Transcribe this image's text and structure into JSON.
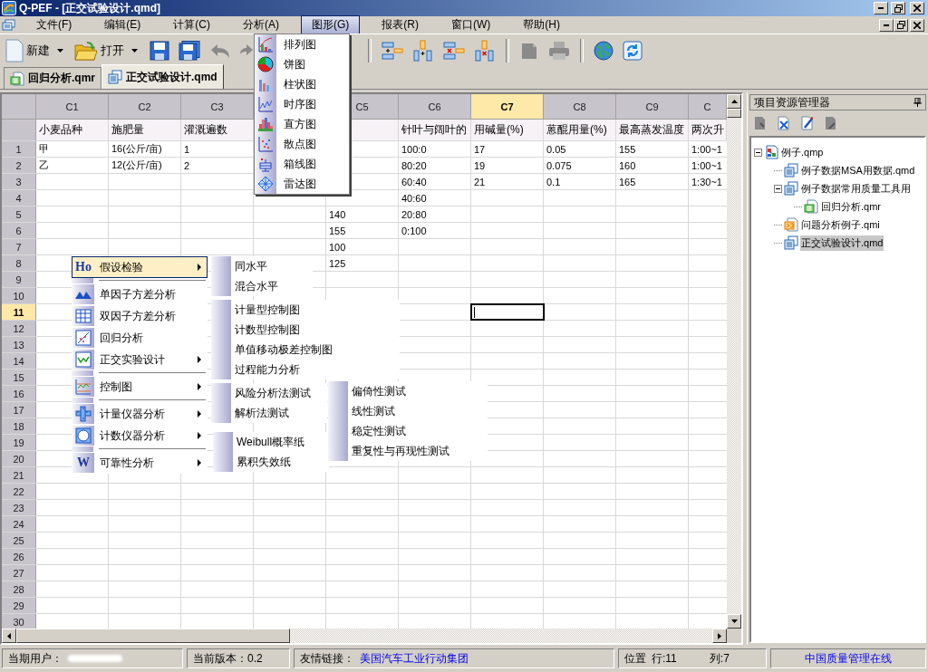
{
  "window": {
    "title": "Q-PEF - [正交试验设计.qmd]"
  },
  "menu": [
    {
      "label": "文件(F)",
      "selected": false
    },
    {
      "label": "编辑(E)",
      "selected": false
    },
    {
      "label": "计算(C)",
      "selected": false
    },
    {
      "label": "分析(A)",
      "selected": false
    },
    {
      "label": "图形(G)",
      "selected": true
    },
    {
      "label": "报表(R)",
      "selected": false
    },
    {
      "label": "窗口(W)",
      "selected": false
    },
    {
      "label": "帮助(H)",
      "selected": false
    }
  ],
  "toolbar": {
    "new_label": "新建",
    "open_label": "打开"
  },
  "tabs": [
    {
      "label": "回归分析.qmr",
      "selected": false,
      "kind": "report"
    },
    {
      "label": "正交试验设计.qmd",
      "selected": true,
      "kind": "data"
    }
  ],
  "graph_menu": [
    "排列图",
    "饼图",
    "柱状图",
    "时序图",
    "直方图",
    "散点图",
    "箱线图",
    "雷达图"
  ],
  "table": {
    "columns": [
      {
        "label": "C1",
        "field": "小麦品种",
        "selected": false
      },
      {
        "label": "C2",
        "field": "施肥量",
        "selected": false
      },
      {
        "label": "C3",
        "field": "灌溉遍数",
        "selected": false
      },
      {
        "label": "C5",
        "gap_before": true,
        "selected": false
      },
      {
        "label": "C6",
        "field": "针叶与阔叶的",
        "selected": false
      },
      {
        "label": "C7",
        "field": "用碱量(%)",
        "selected": true
      },
      {
        "label": "C8",
        "field": "蒽醌用量(%)",
        "selected": false
      },
      {
        "label": "C9",
        "field": "最高蒸发温度",
        "selected": false
      },
      {
        "label": "C",
        "field": "两次升",
        "selected": false
      }
    ],
    "rows": [
      {
        "label": "1",
        "selected": false,
        "cells": [
          "甲",
          "16(公斤/亩)",
          "1",
          null,
          "100:0",
          "17",
          "0.05",
          "155",
          "1:00~1"
        ]
      },
      {
        "label": "2",
        "selected": false,
        "cells": [
          "乙",
          "12(公斤/亩)",
          "2",
          null,
          "80:20",
          "19",
          "0.075",
          "160",
          "1:00~1"
        ]
      },
      {
        "label": "3",
        "selected": false,
        "cells": [
          null,
          null,
          null,
          null,
          "60:40",
          "21",
          "0.1",
          "165",
          "1:30~1"
        ]
      },
      {
        "label": "4",
        "selected": false,
        "cells": [
          null,
          null,
          null,
          null,
          "40:60"
        ]
      },
      {
        "label": "5",
        "selected": false,
        "cells": [
          null,
          null,
          null,
          "140",
          "20:80"
        ]
      },
      {
        "label": "6",
        "selected": false,
        "cells": [
          null,
          null,
          null,
          "155",
          "0:100"
        ]
      },
      {
        "label": "7",
        "selected": false,
        "cells": [
          null,
          null,
          null,
          "100"
        ]
      },
      {
        "label": "8",
        "selected": false,
        "cells": [
          null,
          null,
          null,
          "125"
        ]
      },
      {
        "label": "9",
        "selected": false
      },
      {
        "label": "10",
        "selected": false
      },
      {
        "label": "11",
        "selected": true
      },
      {
        "label": "12",
        "selected": false
      },
      {
        "label": "13",
        "selected": false
      },
      {
        "label": "14",
        "selected": false
      },
      {
        "label": "15",
        "selected": false
      },
      {
        "label": "16",
        "selected": false
      },
      {
        "label": "17",
        "selected": false
      },
      {
        "label": "18",
        "selected": false
      },
      {
        "label": "19",
        "selected": false
      },
      {
        "label": "20",
        "selected": false
      },
      {
        "label": "21",
        "selected": false
      },
      {
        "label": "22",
        "selected": false
      },
      {
        "label": "23",
        "selected": false
      },
      {
        "label": "24",
        "selected": false
      },
      {
        "label": "25",
        "selected": false
      },
      {
        "label": "26",
        "selected": false
      },
      {
        "label": "27",
        "selected": false
      },
      {
        "label": "28",
        "selected": false
      },
      {
        "label": "29",
        "selected": false
      },
      {
        "label": "30",
        "selected": false
      }
    ]
  },
  "context_menu": [
    {
      "kind": "item",
      "label": "假设检验",
      "icon_text": "Ho",
      "submenu": true,
      "selected": true
    },
    {
      "kind": "separator"
    },
    {
      "kind": "item",
      "label": "单因子方差分析",
      "submenu": false,
      "selected": false
    },
    {
      "kind": "item",
      "label": "双因子方差分析",
      "submenu": false,
      "selected": false
    },
    {
      "kind": "item",
      "label": "回归分析",
      "submenu": false,
      "selected": false
    },
    {
      "kind": "item",
      "label": "正交实验设计",
      "submenu": true,
      "selected": false
    },
    {
      "kind": "separator"
    },
    {
      "kind": "item",
      "label": "控制图",
      "submenu": true,
      "selected": false
    },
    {
      "kind": "separator"
    },
    {
      "kind": "item",
      "label": "计量仪器分析",
      "submenu": true,
      "selected": false
    },
    {
      "kind": "item",
      "label": "计数仪器分析",
      "submenu": true,
      "selected": false
    },
    {
      "kind": "separator"
    },
    {
      "kind": "item",
      "label": "可靠性分析",
      "icon_text": "W",
      "submenu": true,
      "selected": false
    }
  ],
  "submenus": [
    [
      "同水平",
      "混合水平"
    ],
    [
      "计量型控制图",
      "计数型控制图",
      "单值移动极差控制图",
      "过程能力分析"
    ],
    [
      "风险分析法测试",
      "解析法测试"
    ],
    [
      "Weibull概率纸",
      "累积失效纸"
    ],
    [
      "偏倚性测试",
      "线性测试",
      "稳定性测试",
      "重复性与再现性测试"
    ]
  ],
  "explorer": {
    "title": "项目资源管理器",
    "nodes": [
      {
        "label": "例子.qmp",
        "kind": "project",
        "expanded": true,
        "selected": false,
        "children": [
          {
            "label": "例子数据MSA用数据.qmd",
            "kind": "data",
            "selected": false
          },
          {
            "label": "例子数据常用质量工具用",
            "kind": "data",
            "expanded": true,
            "selected": false,
            "children": [
              {
                "label": "回归分析.qmr",
                "kind": "report",
                "selected": false
              }
            ]
          },
          {
            "label": "问题分析例子.qmi",
            "kind": "issue",
            "selected": false
          },
          {
            "label": "正交试验设计.qmd",
            "kind": "data",
            "selected": true
          }
        ]
      }
    ]
  },
  "status_bar": {
    "user_label": "当期用户：",
    "version": "当前版本：0.2",
    "links_label": "友情链接：",
    "link": "美国汽车工业行动集团",
    "position_label": "位置",
    "row": "行:11",
    "column": "列:7",
    "site_link": "中国质量管理在线"
  }
}
